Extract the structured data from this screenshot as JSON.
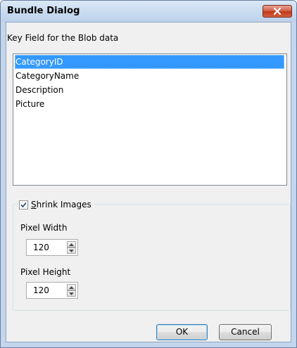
{
  "window": {
    "title": "Bundle Dialog"
  },
  "key_field": {
    "label": "Key Field for the Blob data",
    "items": [
      {
        "label": "CategoryID",
        "selected": true
      },
      {
        "label": "CategoryName",
        "selected": false
      },
      {
        "label": "Description",
        "selected": false
      },
      {
        "label": "Picture",
        "selected": false
      }
    ]
  },
  "shrink": {
    "label": "Shrink Images",
    "checked": true,
    "width_label": "Pixel Width",
    "width_value": "120",
    "height_label": "Pixel Height",
    "height_value": "120"
  },
  "buttons": {
    "ok": "OK",
    "cancel": "Cancel"
  },
  "colors": {
    "selection": "#3399ff",
    "titlebar": "#c8dbf0",
    "close": "#c0391b"
  },
  "icons": {
    "close": "close-icon",
    "check": "check-icon",
    "spin_up": "spin-up-icon",
    "spin_down": "spin-down-icon"
  }
}
